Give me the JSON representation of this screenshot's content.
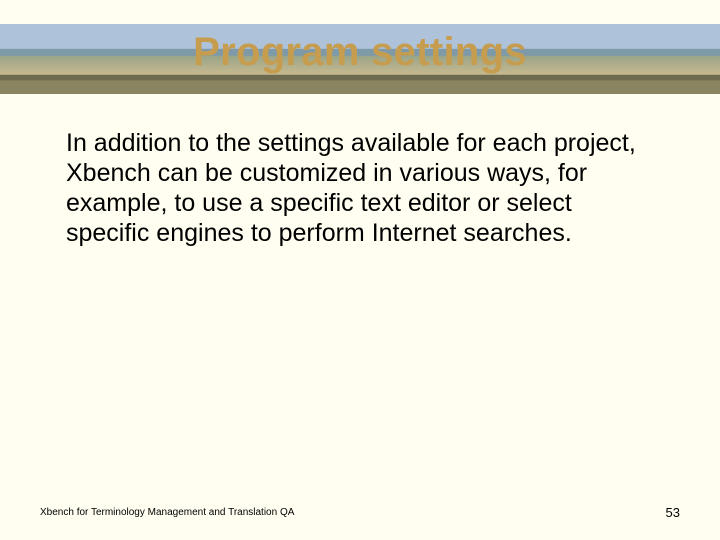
{
  "title": "Program settings",
  "body": "In addition to the settings available for each project, Xbench can be customized in various ways, for example, to use a specific text editor or select specific engines to perform Internet searches.",
  "footer_left": "Xbench for Terminology Management and Translation QA",
  "page_number": "53"
}
